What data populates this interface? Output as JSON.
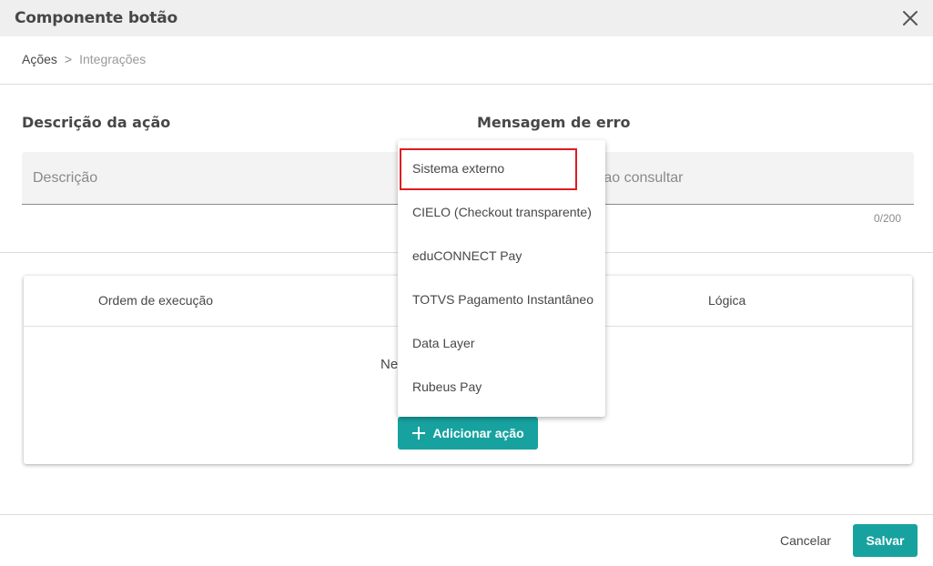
{
  "dialog": {
    "title": "Componente botão",
    "close_icon": "close-icon"
  },
  "breadcrumb": {
    "items": [
      "Ações",
      "Integrações"
    ],
    "separator": ">"
  },
  "form": {
    "description": {
      "label": "Descrição da ação",
      "placeholder": "Descrição",
      "value": ""
    },
    "error_message": {
      "label": "Mensagem de erro",
      "visible_placeholder_fragment": "o ao consultar",
      "value": "",
      "counter": "0/200"
    }
  },
  "actions_table": {
    "columns": [
      "Ordem de execução",
      "Lógica"
    ],
    "empty_text_fragment": "Ne",
    "add_button_label": "Adicionar ação",
    "add_icon": "plus-icon"
  },
  "integration_menu": {
    "items": [
      "Sistema externo",
      "CIELO (Checkout transparente)",
      "eduCONNECT Pay",
      "TOTVS Pagamento Instantâneo",
      "Data Layer",
      "Rubeus Pay"
    ],
    "highlighted_item": "Sistema externo",
    "highlight_color": "#e01b22"
  },
  "footer": {
    "cancel_label": "Cancelar",
    "save_label": "Salvar"
  },
  "colors": {
    "accent": "#17a2a0",
    "header_bg": "#efefef",
    "text": "#474747"
  }
}
